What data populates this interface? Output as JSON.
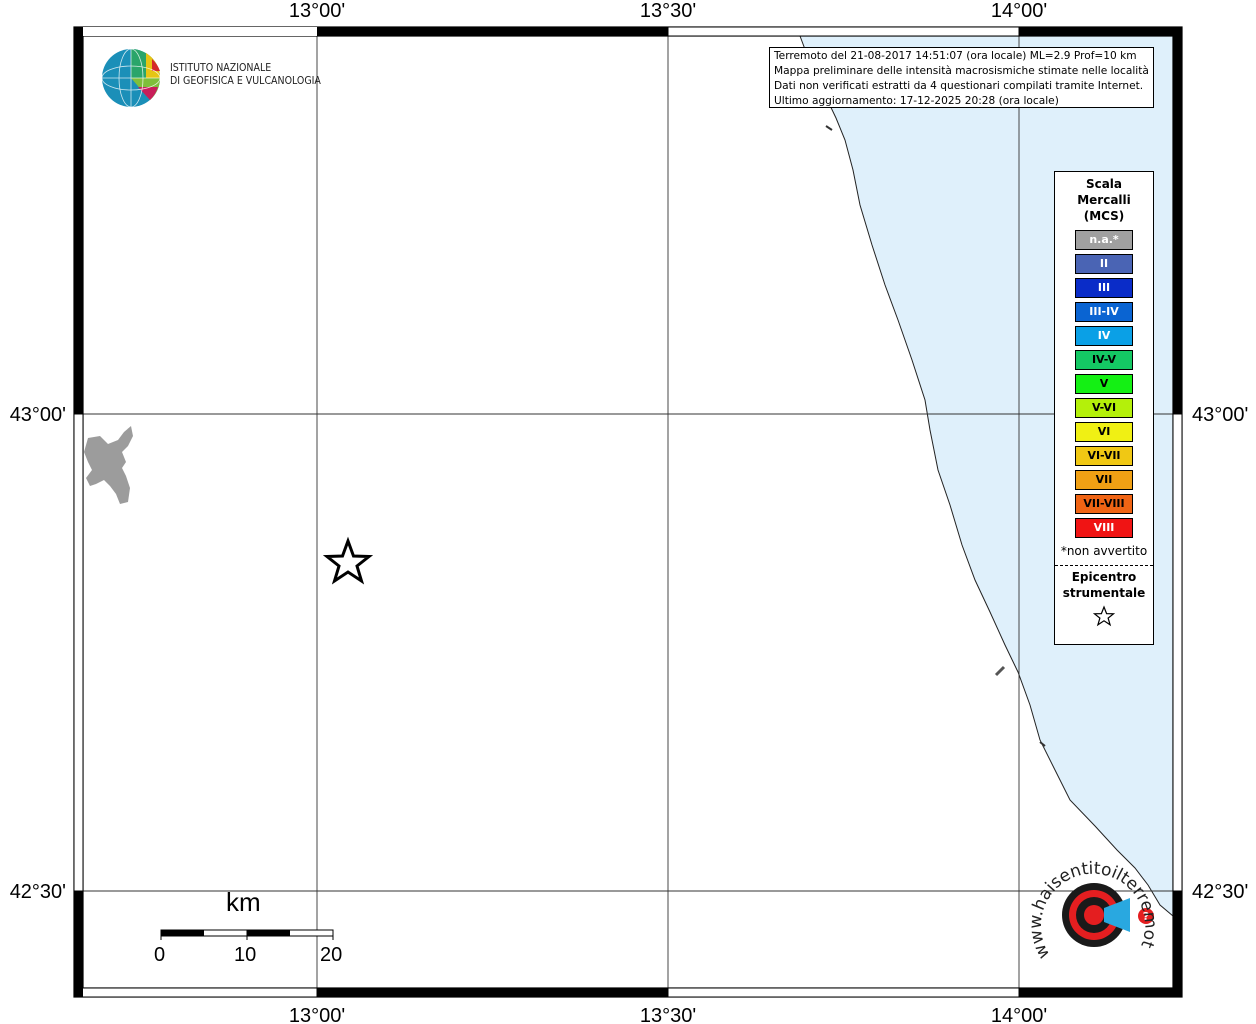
{
  "map": {
    "lon_labels": [
      "13°00'",
      "13°30'",
      "14°00'"
    ],
    "lat_labels": [
      "43°00'",
      "42°30'"
    ],
    "sea_color": "#dff0fb",
    "land_color": "#ffffff",
    "lake_color": "#9c9c9c",
    "epicenter_marker": "star-icon"
  },
  "info": {
    "line1": "Terremoto del 21-08-2017 14:51:07 (ora locale) ML=2.9 Prof=10 km",
    "line2": "Mappa preliminare delle intensità macrosismiche stimate nelle località",
    "line3": "Dati non verificati estratti da 4 questionari compilati tramite Internet.",
    "line4": "Ultimo aggiornamento: 17-12-2025 20:28 (ora locale)"
  },
  "logo": {
    "line1": "ISTITUTO NAZIONALE",
    "line2": "DI GEOFISICA E VULCANOLOGIA",
    "watermark_text": "www.haisentitoilterremoto.it"
  },
  "legend": {
    "title1": "Scala",
    "title2": "Mercalli",
    "title3": "(MCS)",
    "items": [
      {
        "label": "n.a.*",
        "color": "#a0a0a0",
        "text_color": "#ffffff"
      },
      {
        "label": "II",
        "color": "#4a64b4",
        "text_color": "#ffffff"
      },
      {
        "label": "III",
        "color": "#0a2cc8",
        "text_color": "#ffffff"
      },
      {
        "label": "III-IV",
        "color": "#0a64d2",
        "text_color": "#ffffff"
      },
      {
        "label": "IV",
        "color": "#0aa0e6",
        "text_color": "#ffffff"
      },
      {
        "label": "IV-V",
        "color": "#14c864",
        "text_color": "#000000"
      },
      {
        "label": "V",
        "color": "#14f014",
        "text_color": "#000000"
      },
      {
        "label": "V-VI",
        "color": "#b4f00a",
        "text_color": "#000000"
      },
      {
        "label": "VI",
        "color": "#f0f014",
        "text_color": "#000000"
      },
      {
        "label": "VI-VII",
        "color": "#f0c814",
        "text_color": "#000000"
      },
      {
        "label": "VII",
        "color": "#f0a014",
        "text_color": "#000000"
      },
      {
        "label": "VII-VIII",
        "color": "#f06414",
        "text_color": "#000000"
      },
      {
        "label": "VIII",
        "color": "#f01414",
        "text_color": "#ffffff"
      }
    ],
    "note": "*non avvertito",
    "epicenter1": "Epicentro",
    "epicenter2": "strumentale"
  },
  "scale_bar": {
    "unit": "km",
    "labels": [
      "0",
      "10",
      "20"
    ]
  }
}
